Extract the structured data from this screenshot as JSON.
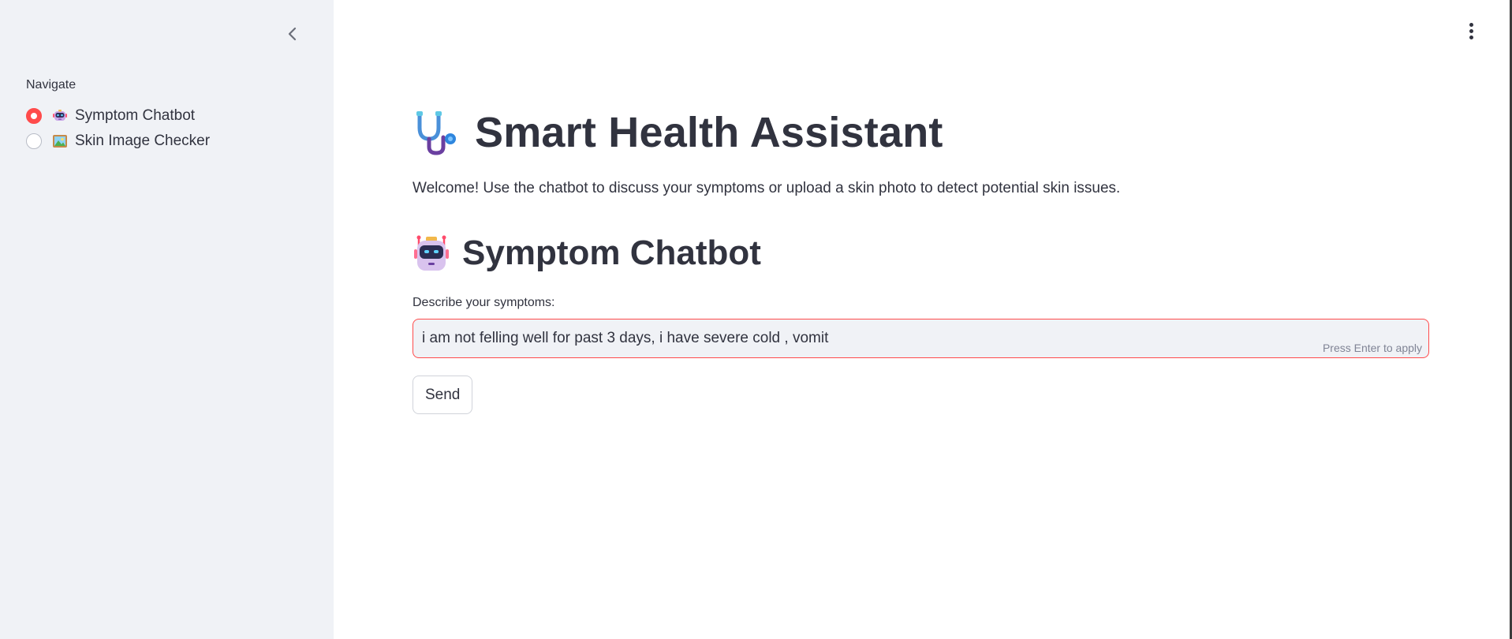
{
  "sidebar": {
    "collapse_icon": "chevron-left-icon",
    "nav_label": "Navigate",
    "items": [
      {
        "label": "Symptom Chatbot",
        "icon": "robot-emoji",
        "selected": true
      },
      {
        "label": "Skin Image Checker",
        "icon": "framed-picture-emoji",
        "selected": false
      }
    ]
  },
  "header": {
    "menu_icon": "kebab-menu-icon"
  },
  "main": {
    "title": "Smart Health Assistant",
    "title_icon": "stethoscope-emoji",
    "welcome": "Welcome! Use the chatbot to discuss your symptoms or upload a skin photo to detect potential skin issues.",
    "section_title": "Symptom Chatbot",
    "section_icon": "robot-emoji",
    "input_label": "Describe your symptoms:",
    "input_value": "i am not felling well for past 3 days, i have severe cold , vomit",
    "input_hint": "Press Enter to apply",
    "send_label": "Send"
  },
  "colors": {
    "accent": "#ff4b4b",
    "sidebar_bg": "#f0f2f6",
    "text": "#31333f"
  }
}
